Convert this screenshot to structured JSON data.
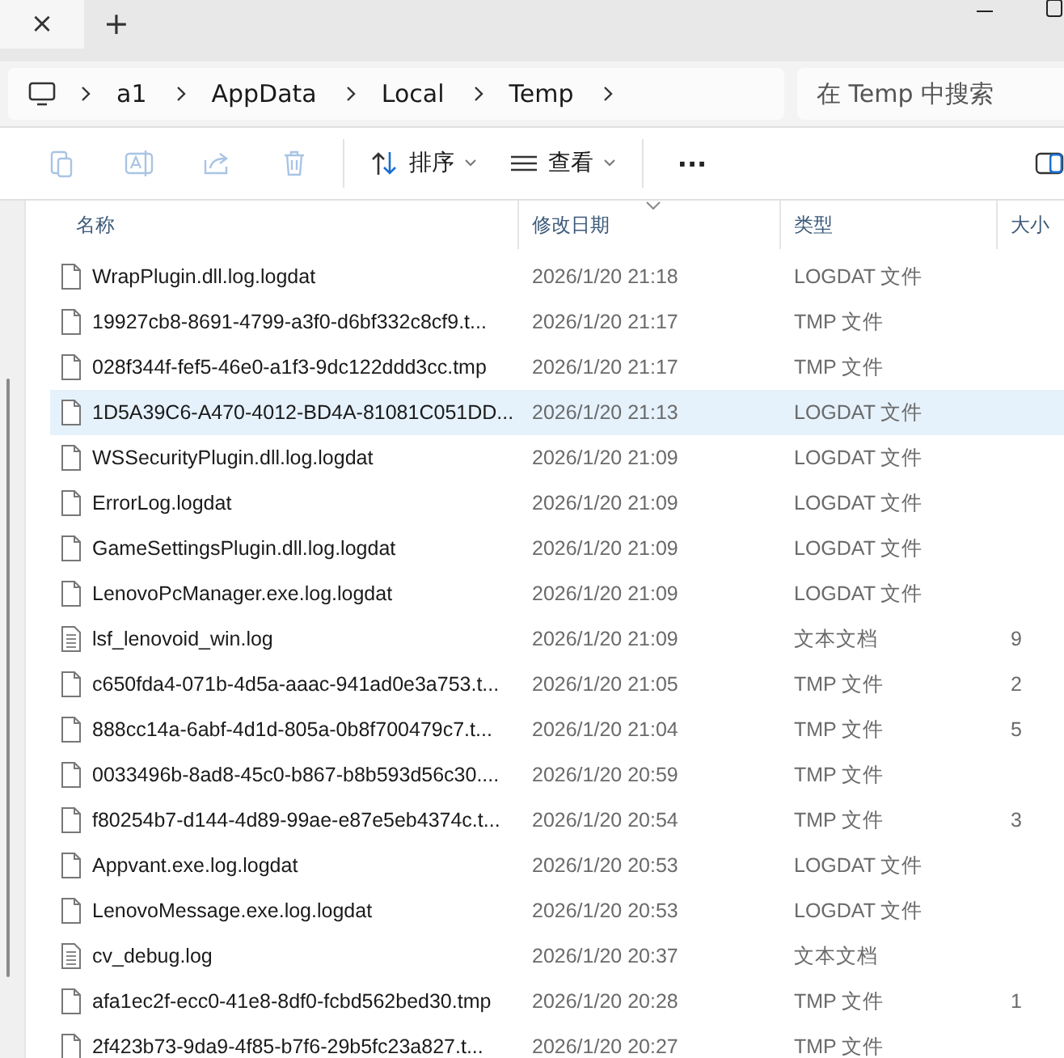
{
  "tabs": [
    {
      "kind": "close",
      "label": "×",
      "selected": true
    },
    {
      "kind": "new",
      "label": "+",
      "selected": false
    }
  ],
  "breadcrumb": [
    "a1",
    "AppData",
    "Local",
    "Temp"
  ],
  "search": {
    "placeholder": "在 Temp 中搜索"
  },
  "toolbar": [
    {
      "kind": "copy",
      "disabled": true
    },
    {
      "kind": "rename",
      "disabled": true
    },
    {
      "kind": "share",
      "disabled": true
    },
    {
      "kind": "delete",
      "disabled": true
    },
    {
      "kind": "sort",
      "label": "排序",
      "disabled": false
    },
    {
      "kind": "view",
      "label": "查看",
      "disabled": false
    },
    {
      "kind": "more",
      "label": "···",
      "disabled": false
    },
    {
      "kind": "pane",
      "disabled": false
    }
  ],
  "columns": [
    "名称",
    "修改日期",
    "类型",
    "大小"
  ],
  "rows": [
    {
      "name": "WrapPlugin.dll.log.logdat",
      "date": "2026/1/20 21:18",
      "type": "LOGDAT 文件",
      "kind": "file",
      "selected": false
    },
    {
      "name": "19927cb8-8691-4799-a3f0-d6bf332c8cf9.t...",
      "date": "2026/1/20 21:17",
      "type": "TMP 文件",
      "kind": "file",
      "selected": false
    },
    {
      "name": "028f344f-fef5-46e0-a1f3-9dc122ddd3cc.tmp",
      "date": "2026/1/20 21:17",
      "type": "TMP 文件",
      "kind": "file",
      "selected": false
    },
    {
      "name": "1D5A39C6-A470-4012-BD4A-81081C051DD...",
      "date": "2026/1/20 21:13",
      "type": "LOGDAT 文件",
      "kind": "file",
      "selected": true
    },
    {
      "name": "WSSecurityPlugin.dll.log.logdat",
      "date": "2026/1/20 21:09",
      "type": "LOGDAT 文件",
      "kind": "file",
      "selected": false
    },
    {
      "name": "ErrorLog.logdat",
      "date": "2026/1/20 21:09",
      "type": "LOGDAT 文件",
      "kind": "file",
      "selected": false
    },
    {
      "name": "GameSettingsPlugin.dll.log.logdat",
      "date": "2026/1/20 21:09",
      "type": "LOGDAT 文件",
      "kind": "file",
      "selected": false
    },
    {
      "name": "LenovoPcManager.exe.log.logdat",
      "date": "2026/1/20 21:09",
      "type": "LOGDAT 文件",
      "kind": "file",
      "selected": false
    },
    {
      "name": "lsf_lenovoid_win.log",
      "date": "2026/1/20 21:09",
      "type": "文本文档",
      "size": "9",
      "kind": "text",
      "selected": false
    },
    {
      "name": "c650fda4-071b-4d5a-aaac-941ad0e3a753.t...",
      "date": "2026/1/20 21:05",
      "type": "TMP 文件",
      "size": "2",
      "kind": "file",
      "selected": false
    },
    {
      "name": "888cc14a-6abf-4d1d-805a-0b8f700479c7.t...",
      "date": "2026/1/20 21:04",
      "type": "TMP 文件",
      "size": "5",
      "kind": "file",
      "selected": false
    },
    {
      "name": "0033496b-8ad8-45c0-b867-b8b593d56c30....",
      "date": "2026/1/20 20:59",
      "type": "TMP 文件",
      "kind": "file",
      "selected": false
    },
    {
      "name": "f80254b7-d144-4d89-99ae-e87e5eb4374c.t...",
      "date": "2026/1/20 20:54",
      "type": "TMP 文件",
      "size": "3",
      "kind": "file",
      "selected": false
    },
    {
      "name": "Appvant.exe.log.logdat",
      "date": "2026/1/20 20:53",
      "type": "LOGDAT 文件",
      "kind": "file",
      "selected": false
    },
    {
      "name": "LenovoMessage.exe.log.logdat",
      "date": "2026/1/20 20:53",
      "type": "LOGDAT 文件",
      "kind": "file",
      "selected": false
    },
    {
      "name": "cv_debug.log",
      "date": "2026/1/20 20:37",
      "type": "文本文档",
      "kind": "text",
      "selected": false
    },
    {
      "name": "afa1ec2f-ecc0-41e8-8df0-fcbd562bed30.tmp",
      "date": "2026/1/20 20:28",
      "type": "TMP 文件",
      "size": "1",
      "kind": "file",
      "selected": false
    },
    {
      "name": "2f423b73-9da9-4f85-b7f6-29b5fc23a827.t...",
      "date": "2026/1/20 20:27",
      "type": "TMP 文件",
      "kind": "file",
      "selected": false
    }
  ]
}
